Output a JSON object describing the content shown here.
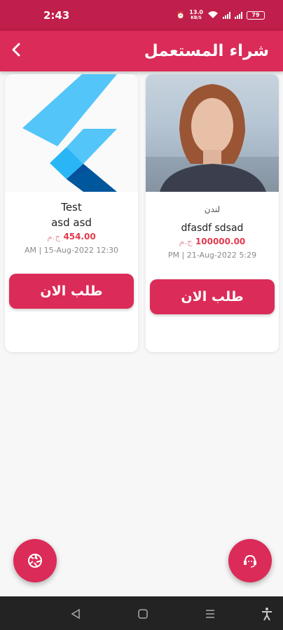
{
  "status_bar": {
    "time": "2:43",
    "speed": "13.0",
    "speed_unit": "KB/S",
    "battery": "79"
  },
  "app_bar": {
    "title": "شراء المستعمل",
    "back_icon": "chevron-left-icon"
  },
  "cards": [
    {
      "image": "flutter-logo",
      "city": "",
      "title_line1": "Test",
      "title_line2": "asd asd",
      "price": "454.00",
      "currency": "ج.م",
      "datetime": "AM | 15-Aug-2022 12:30",
      "button_label": "طلب الان"
    },
    {
      "image": "woman-portrait-photo",
      "city": "لندن",
      "title": "dfasdf sdsad",
      "price": "100000.00",
      "currency": "ج.م",
      "datetime": "PM | 21-Aug-2022 5:29",
      "button_label": "طلب الان"
    }
  ],
  "fabs": {
    "left_icon": "camera-aperture-icon",
    "right_icon": "support-agent-icon"
  },
  "nav_bar": {
    "icons": [
      "back-triangle-icon",
      "home-square-icon",
      "menu-lines-icon",
      "accessibility-icon"
    ]
  },
  "colors": {
    "status_bar": "#bf1f4a",
    "primary": "#db2b58",
    "price": "#e23a4d",
    "background": "#f7f7f7"
  }
}
